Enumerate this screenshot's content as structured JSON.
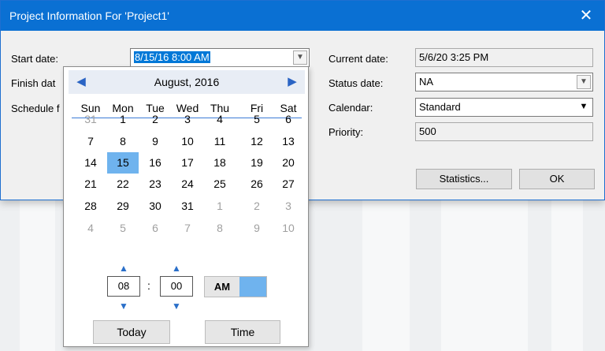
{
  "dialog": {
    "title": "Project Information For 'Project1'",
    "close_glyph": "✕"
  },
  "left": {
    "start_label": "Start date:",
    "start_value": "8/15/16 8:00 AM",
    "finish_label": "Finish dat",
    "schedule_label": "Schedule f"
  },
  "right": {
    "current_label": "Current date:",
    "current_value": "5/6/20 3:25 PM",
    "status_label": "Status date:",
    "status_value": "NA",
    "calendar_label": "Calendar:",
    "calendar_value": "Standard",
    "priority_label": "Priority:",
    "priority_value": "500"
  },
  "buttons": {
    "statistics": "Statistics...",
    "ok": "OK"
  },
  "calendar": {
    "month_label": "August, 2016",
    "prev_glyph": "◀",
    "next_glyph": "▶",
    "weekdays": [
      "Sun",
      "Mon",
      "Tue",
      "Wed",
      "Thu",
      "Fri",
      "Sat"
    ],
    "weeks": [
      [
        "31",
        "1",
        "2",
        "3",
        "4",
        "5",
        "6"
      ],
      [
        "7",
        "8",
        "9",
        "10",
        "11",
        "12",
        "13"
      ],
      [
        "14",
        "15",
        "16",
        "17",
        "18",
        "19",
        "20"
      ],
      [
        "21",
        "22",
        "23",
        "24",
        "25",
        "26",
        "27"
      ],
      [
        "28",
        "29",
        "30",
        "31",
        "1",
        "2",
        "3"
      ],
      [
        "4",
        "5",
        "6",
        "7",
        "8",
        "9",
        "10"
      ]
    ],
    "selected_day": "15",
    "hour": "08",
    "minute": "00",
    "colon": ":",
    "am_label": "AM",
    "today_label": "Today",
    "time_label": "Time"
  },
  "colors": {
    "title_bar": "#0a70d3",
    "selection": "#0078d7",
    "selected_day": "#6fb3ee",
    "nav_arrow": "#2a64c4"
  },
  "icons": {
    "close": "close-icon",
    "dropdown": "chevron-down-icon",
    "prev": "prev-month-arrow-icon",
    "next": "next-month-arrow-icon"
  }
}
